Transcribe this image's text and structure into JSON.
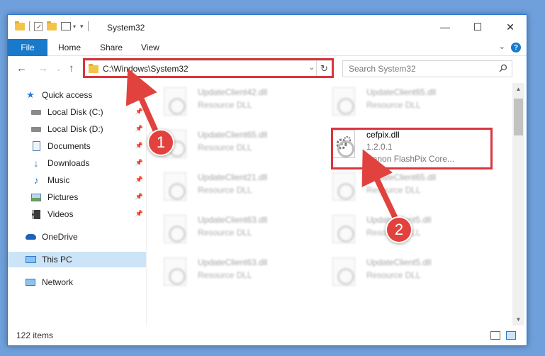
{
  "window": {
    "title": "System32",
    "controls": {
      "minimize": "—",
      "maximize": "☐",
      "close": "✕"
    }
  },
  "ribbon": {
    "file": "File",
    "tabs": [
      "Home",
      "Share",
      "View"
    ],
    "help": "?"
  },
  "address": {
    "path": "C:\\Windows\\System32",
    "search_placeholder": "Search System32"
  },
  "sidebar": {
    "items": [
      {
        "label": "Quick access",
        "icon": "star-icon"
      },
      {
        "label": "Local Disk (C:)",
        "icon": "drive-icon",
        "pinned": true
      },
      {
        "label": "Local Disk (D:)",
        "icon": "drive-icon",
        "pinned": true
      },
      {
        "label": "Documents",
        "icon": "documents-icon",
        "pinned": true
      },
      {
        "label": "Downloads",
        "icon": "download-icon",
        "pinned": true
      },
      {
        "label": "Music",
        "icon": "music-icon",
        "pinned": true
      },
      {
        "label": "Pictures",
        "icon": "pictures-icon",
        "pinned": true
      },
      {
        "label": "Videos",
        "icon": "videos-icon",
        "pinned": true
      },
      {
        "label": "OneDrive",
        "icon": "cloud-icon"
      },
      {
        "label": "This PC",
        "icon": "computer-icon",
        "selected": true
      },
      {
        "label": "Network",
        "icon": "network-icon"
      }
    ]
  },
  "files": {
    "left": [
      {
        "name": "UpdateClient42.dll",
        "type": "Resource DLL"
      },
      {
        "name": "UpdateClient65.dll",
        "type": "Resource DLL"
      },
      {
        "name": "UpdateClient21.dll",
        "type": "Resource DLL"
      },
      {
        "name": "UpdateClient63.dll",
        "type": "Resource DLL"
      },
      {
        "name": "UpdateClient63.dll",
        "type": "Resource DLL"
      }
    ],
    "right": [
      {
        "name": "UpdateClient65.dll",
        "type": "Resource DLL"
      },
      {
        "name": "cefpix.dll",
        "version": "1.2.0.1",
        "description": "Canon FlashPix Core..."
      },
      {
        "name": "UpdateClient65.dll",
        "type": "Resource DLL"
      },
      {
        "name": "UpdateClient5.dll",
        "type": "Resource DLL"
      },
      {
        "name": "UpdateClient5.dll",
        "type": "Resource DLL"
      }
    ]
  },
  "status": {
    "items": "122 items"
  },
  "annotations": {
    "step1": "1",
    "step2": "2"
  },
  "colors": {
    "accent": "#1979ca",
    "highlight": "#d9363e",
    "selected": "#cce4f7"
  }
}
